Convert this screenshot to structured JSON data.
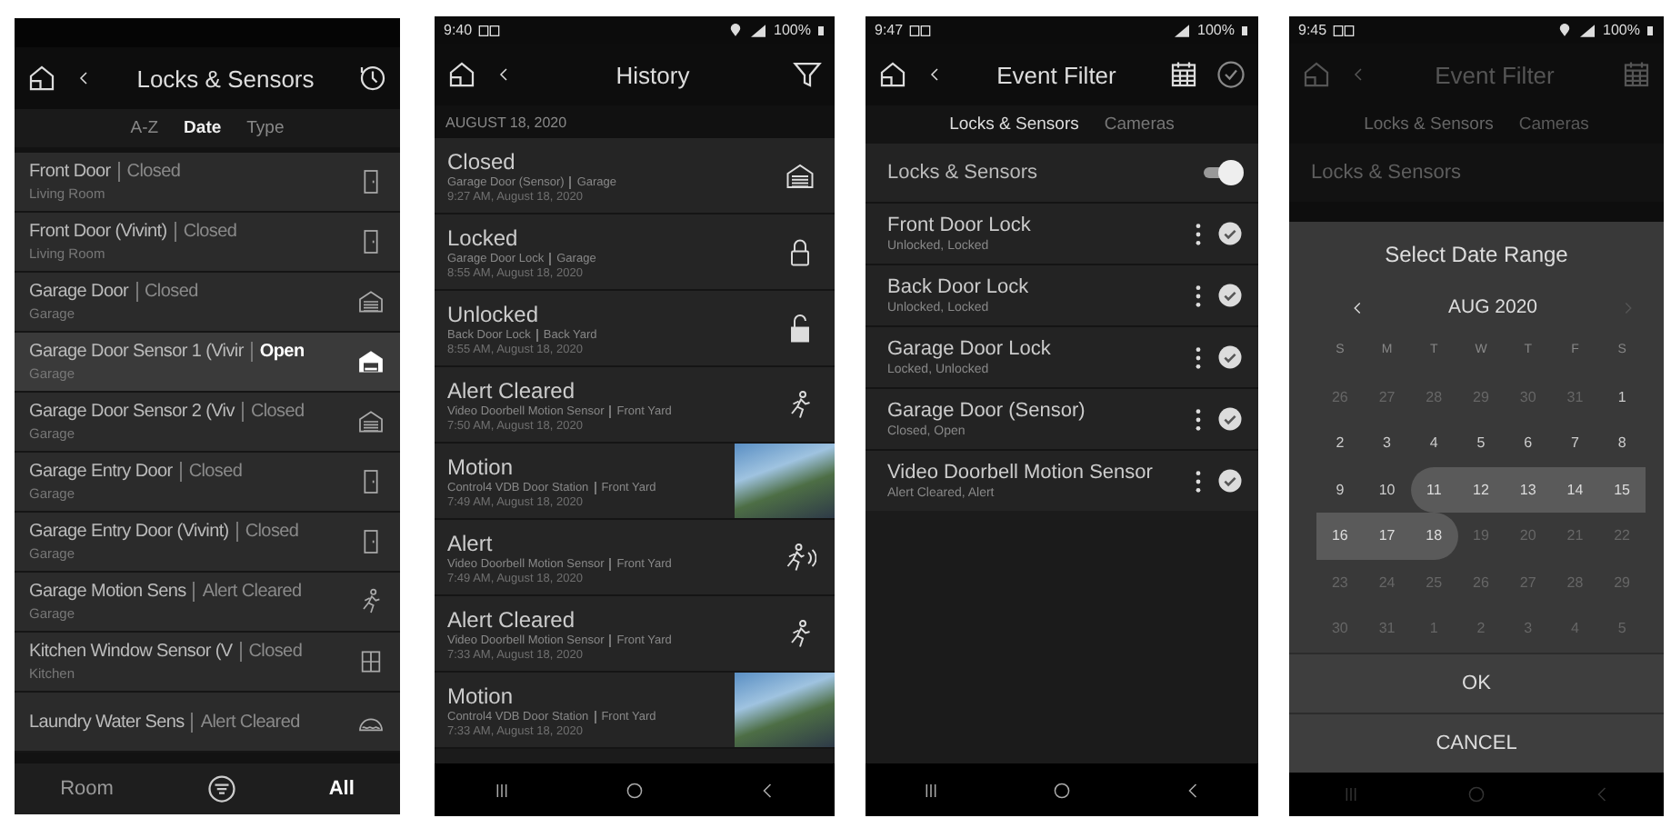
{
  "locks_sensors_screen": {
    "title": "Locks & Sensors",
    "sort_tabs": [
      {
        "label": "A-Z",
        "selected": false
      },
      {
        "label": "Date",
        "selected": true
      },
      {
        "label": "Type",
        "selected": false
      }
    ],
    "devices": [
      {
        "name": "Front Door",
        "status": "Closed",
        "room": "Living Room",
        "kind": "door",
        "active": false
      },
      {
        "name": "Front Door (Vivint)",
        "status": "Closed",
        "room": "Living Room",
        "kind": "door",
        "active": false
      },
      {
        "name": "Garage Door",
        "status": "Closed",
        "room": "Garage",
        "kind": "garage",
        "active": false
      },
      {
        "name": "Garage Door Sensor 1 (Vivir",
        "status": "Open",
        "room": "Garage",
        "kind": "garage",
        "active": true
      },
      {
        "name": "Garage Door Sensor 2 (Viv",
        "status": "Closed",
        "room": "Garage",
        "kind": "garage",
        "active": false
      },
      {
        "name": "Garage Entry Door",
        "status": "Closed",
        "room": "Garage",
        "kind": "door",
        "active": false
      },
      {
        "name": "Garage Entry Door (Vivint)",
        "status": "Closed",
        "room": "Garage",
        "kind": "door",
        "active": false
      },
      {
        "name": "Garage Motion Sens",
        "status": "Alert Cleared",
        "room": "Garage",
        "kind": "motion",
        "active": false
      },
      {
        "name": "Kitchen Window Sensor (V",
        "status": "Closed",
        "room": "Kitchen",
        "kind": "window",
        "active": false
      },
      {
        "name": "Laundry Water Sens",
        "status": "Alert Cleared",
        "kind": "water",
        "active": false
      }
    ],
    "bottom_tabs": [
      {
        "label": "Room",
        "selected": false
      },
      {
        "label": "All",
        "selected": true
      }
    ]
  },
  "history_screen": {
    "status_bar": {
      "time": "9:40",
      "battery": "100%",
      "location_on": true
    },
    "title": "History",
    "date": "AUGUST 18, 2020",
    "events": [
      {
        "title": "Closed",
        "device": "Garage Door (Sensor)",
        "location": "Garage",
        "time": "9:27 AM, August 18, 2020",
        "kind": "garage"
      },
      {
        "title": "Locked",
        "device": "Garage Door Lock",
        "location": "Garage",
        "time": "8:55 AM, August 18, 2020",
        "kind": "lock"
      },
      {
        "title": "Unlocked",
        "device": "Back Door Lock",
        "location": "Back Yard",
        "time": "8:55 AM, August 18, 2020",
        "kind": "unlock"
      },
      {
        "title": "Alert Cleared",
        "device": "Video Doorbell Motion Sensor",
        "location": "Front Yard",
        "time": "7:50 AM, August 18, 2020",
        "kind": "motion"
      },
      {
        "title": "Motion",
        "device": "Control4 VDB Door Station",
        "location": "Front Yard",
        "time": "7:49 AM, August 18, 2020",
        "kind": "camera"
      },
      {
        "title": "Alert",
        "device": "Video Doorbell Motion Sensor",
        "location": "Front Yard",
        "time": "7:49 AM, August 18, 2020",
        "kind": "motion_alert"
      },
      {
        "title": "Alert Cleared",
        "device": "Video Doorbell Motion Sensor",
        "location": "Front Yard",
        "time": "7:33 AM, August 18, 2020",
        "kind": "motion"
      },
      {
        "title": "Motion",
        "device": "Control4 VDB Door Station",
        "location": "Front Yard",
        "time": "7:33 AM, August 18, 2020",
        "kind": "camera"
      }
    ]
  },
  "event_filter_screen": {
    "status_bar": {
      "time": "9:47",
      "battery": "100%",
      "location_on": false
    },
    "title": "Event Filter",
    "tabs": [
      {
        "label": "Locks & Sensors",
        "selected": true
      },
      {
        "label": "Cameras",
        "selected": false
      }
    ],
    "master_toggle": {
      "label": "Locks & Sensors",
      "on": true
    },
    "devices": [
      {
        "name": "Front Door Lock",
        "events": "Unlocked, Locked",
        "checked": true
      },
      {
        "name": "Back Door Lock",
        "events": "Unlocked, Locked",
        "checked": true
      },
      {
        "name": "Garage Door Lock",
        "events": "Locked, Unlocked",
        "checked": true
      },
      {
        "name": "Garage Door (Sensor)",
        "events": "Closed, Open",
        "checked": true
      },
      {
        "name": "Video Doorbell Motion Sensor",
        "events": "Alert Cleared, Alert",
        "checked": true
      }
    ]
  },
  "date_range_screen": {
    "status_bar": {
      "time": "9:45",
      "battery": "100%",
      "location_on": true
    },
    "backdrop": {
      "title": "Event Filter",
      "tabs": [
        {
          "label": "Locks & Sensors",
          "selected": true
        },
        {
          "label": "Cameras",
          "selected": false
        }
      ],
      "toggle_label": "Locks & Sensors"
    },
    "dialog": {
      "title": "Select Date Range",
      "month": "AUG 2020",
      "prev_disabled": false,
      "next_disabled": true,
      "weekdays": [
        "S",
        "M",
        "T",
        "W",
        "T",
        "F",
        "S"
      ],
      "weeks": [
        [
          {
            "day": "26",
            "muted": true,
            "selected": false
          },
          {
            "day": "27",
            "muted": true,
            "selected": false
          },
          {
            "day": "28",
            "muted": true,
            "selected": false
          },
          {
            "day": "29",
            "muted": true,
            "selected": false
          },
          {
            "day": "30",
            "muted": true,
            "selected": false
          },
          {
            "day": "31",
            "muted": true,
            "selected": false
          },
          {
            "day": "1",
            "muted": false,
            "selected": false
          }
        ],
        [
          {
            "day": "2",
            "muted": false,
            "selected": false
          },
          {
            "day": "3",
            "muted": false,
            "selected": false
          },
          {
            "day": "4",
            "muted": false,
            "selected": false
          },
          {
            "day": "5",
            "muted": false,
            "selected": false
          },
          {
            "day": "6",
            "muted": false,
            "selected": false
          },
          {
            "day": "7",
            "muted": false,
            "selected": false
          },
          {
            "day": "8",
            "muted": false,
            "selected": false
          }
        ],
        [
          {
            "day": "9",
            "muted": false,
            "selected": false
          },
          {
            "day": "10",
            "muted": false,
            "selected": false
          },
          {
            "day": "11",
            "muted": false,
            "selected": true
          },
          {
            "day": "12",
            "muted": false,
            "selected": true
          },
          {
            "day": "13",
            "muted": false,
            "selected": true
          },
          {
            "day": "14",
            "muted": false,
            "selected": true
          },
          {
            "day": "15",
            "muted": false,
            "selected": true
          }
        ],
        [
          {
            "day": "16",
            "muted": false,
            "selected": true
          },
          {
            "day": "17",
            "muted": false,
            "selected": true
          },
          {
            "day": "18",
            "muted": false,
            "selected": true
          },
          {
            "day": "19",
            "muted": true,
            "selected": false
          },
          {
            "day": "20",
            "muted": true,
            "selected": false
          },
          {
            "day": "21",
            "muted": true,
            "selected": false
          },
          {
            "day": "22",
            "muted": true,
            "selected": false
          }
        ],
        [
          {
            "day": "23",
            "muted": true,
            "selected": false
          },
          {
            "day": "24",
            "muted": true,
            "selected": false
          },
          {
            "day": "25",
            "muted": true,
            "selected": false
          },
          {
            "day": "26",
            "muted": true,
            "selected": false
          },
          {
            "day": "27",
            "muted": true,
            "selected": false
          },
          {
            "day": "28",
            "muted": true,
            "selected": false
          },
          {
            "day": "29",
            "muted": true,
            "selected": false
          }
        ],
        [
          {
            "day": "30",
            "muted": true,
            "selected": false
          },
          {
            "day": "31",
            "muted": true,
            "selected": false
          },
          {
            "day": "1",
            "muted": true,
            "selected": false
          },
          {
            "day": "2",
            "muted": true,
            "selected": false
          },
          {
            "day": "3",
            "muted": true,
            "selected": false
          },
          {
            "day": "4",
            "muted": true,
            "selected": false
          },
          {
            "day": "5",
            "muted": true,
            "selected": false
          }
        ]
      ],
      "buttons": [
        "OK",
        "CANCEL"
      ]
    }
  }
}
